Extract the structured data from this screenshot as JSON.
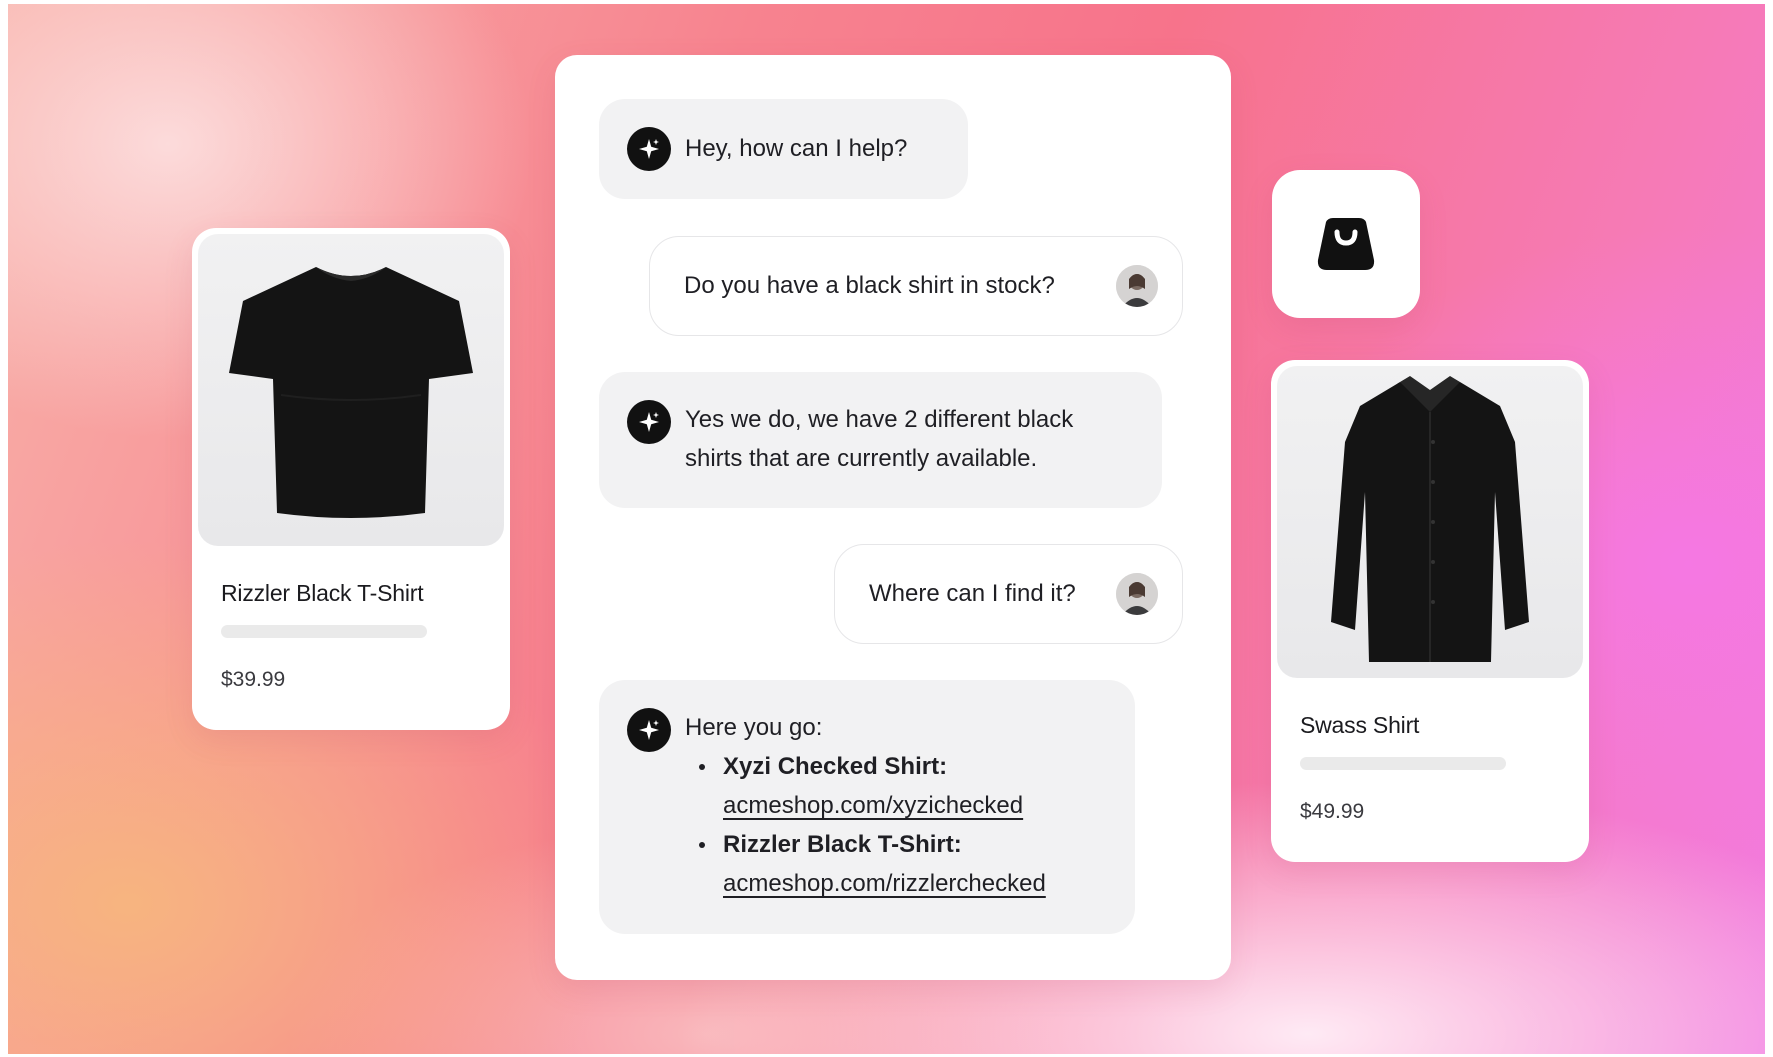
{
  "products": [
    {
      "name": "Rizzler Black T-Shirt",
      "price": "$39.99",
      "image": "black-tshirt-icon"
    },
    {
      "name": "Swass Shirt",
      "price": "$49.99",
      "image": "black-button-shirt-icon"
    }
  ],
  "shop_badge": {
    "icon": "shopping-bag-icon"
  },
  "chat": {
    "assistant_icon": "sparkle-icon",
    "messages": [
      {
        "role": "assistant",
        "text": "Hey, how can I help?"
      },
      {
        "role": "user",
        "text": "Do you have a black shirt in stock?"
      },
      {
        "role": "assistant",
        "text": "Yes we do, we have 2 different black shirts that are currently available."
      },
      {
        "role": "user",
        "text": "Where can I find it?"
      },
      {
        "role": "assistant",
        "text": "Here you go:",
        "items": [
          {
            "label": "Xyzi Checked Shirt:",
            "link": "acmeshop.com/xyzichecked"
          },
          {
            "label": "Rizzler Black T-Shirt:",
            "link": "acmeshop.com/rizzlerchecked"
          }
        ]
      }
    ]
  },
  "colors": {
    "icon_dark": "#111111",
    "bubble_gray": "#f2f2f3",
    "background_pink": "#f7738b",
    "background_orange": "#f7b67e",
    "background_magenta": "#f27be0"
  }
}
